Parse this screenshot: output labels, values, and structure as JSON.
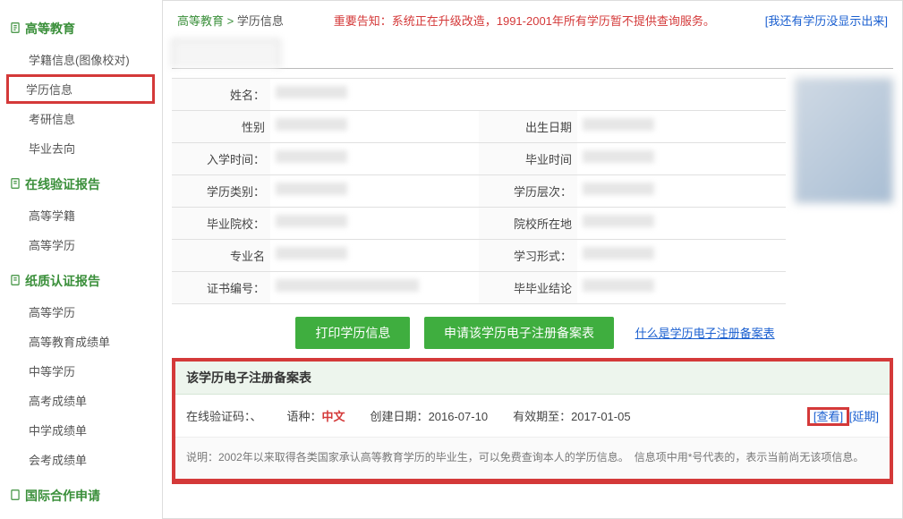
{
  "sidebar": {
    "section1": {
      "title": "高等教育",
      "items": [
        "学籍信息(图像校对)",
        "学历信息",
        "考研信息",
        "毕业去向"
      ]
    },
    "section2": {
      "title": "在线验证报告",
      "items": [
        "高等学籍",
        "高等学历"
      ]
    },
    "section3": {
      "title": "纸质认证报告",
      "items": [
        "高等学历",
        "高等教育成绩单",
        "中等学历",
        "高考成绩单",
        "中学成绩单",
        "会考成绩单"
      ]
    },
    "section4": {
      "title": "国际合作申请"
    }
  },
  "breadcrumb": {
    "root": "高等教育",
    "current": "学历信息"
  },
  "notice": "重要告知：系统正在升级改造，1991-2001年所有学历暂不提供查询服务。",
  "link_missing": "[我还有学历没显示出来]",
  "fields": {
    "name_label": "姓名：",
    "gender_label": "性别",
    "birth_label": "出生日期",
    "enroll_label": "入学时间：",
    "grad_time_label": "毕业时间",
    "degree_type_label": "学历类别：",
    "degree_level_label": "学历层次：",
    "school_label": "毕业院校：",
    "school_loc_label": "院校所在地",
    "major_label": "专业名",
    "study_form_label": "学习形式：",
    "cert_no_label": "证书编号：",
    "grad_conclusion_label": "毕毕业结论"
  },
  "buttons": {
    "print": "打印学历信息",
    "apply": "申请该学历电子注册备案表",
    "what_link": "什么是学历电子注册备案表"
  },
  "reg": {
    "header": "该学历电子注册备案表",
    "verify_label": "在线验证码：、",
    "lang_label": "语种：",
    "lang_value": "中文",
    "created_label": "创建日期：",
    "created_value": "2016-07-10",
    "valid_label": "有效期至：",
    "valid_value": "2017-01-05",
    "view": "[查看]",
    "extend": "[延期]"
  },
  "explain": "说明：2002年以来取得各类国家承认高等教育学历的毕业生，可以免费查询本人的学历信息。　信息项中用*号代表的，表示当前尚无该项信息。"
}
